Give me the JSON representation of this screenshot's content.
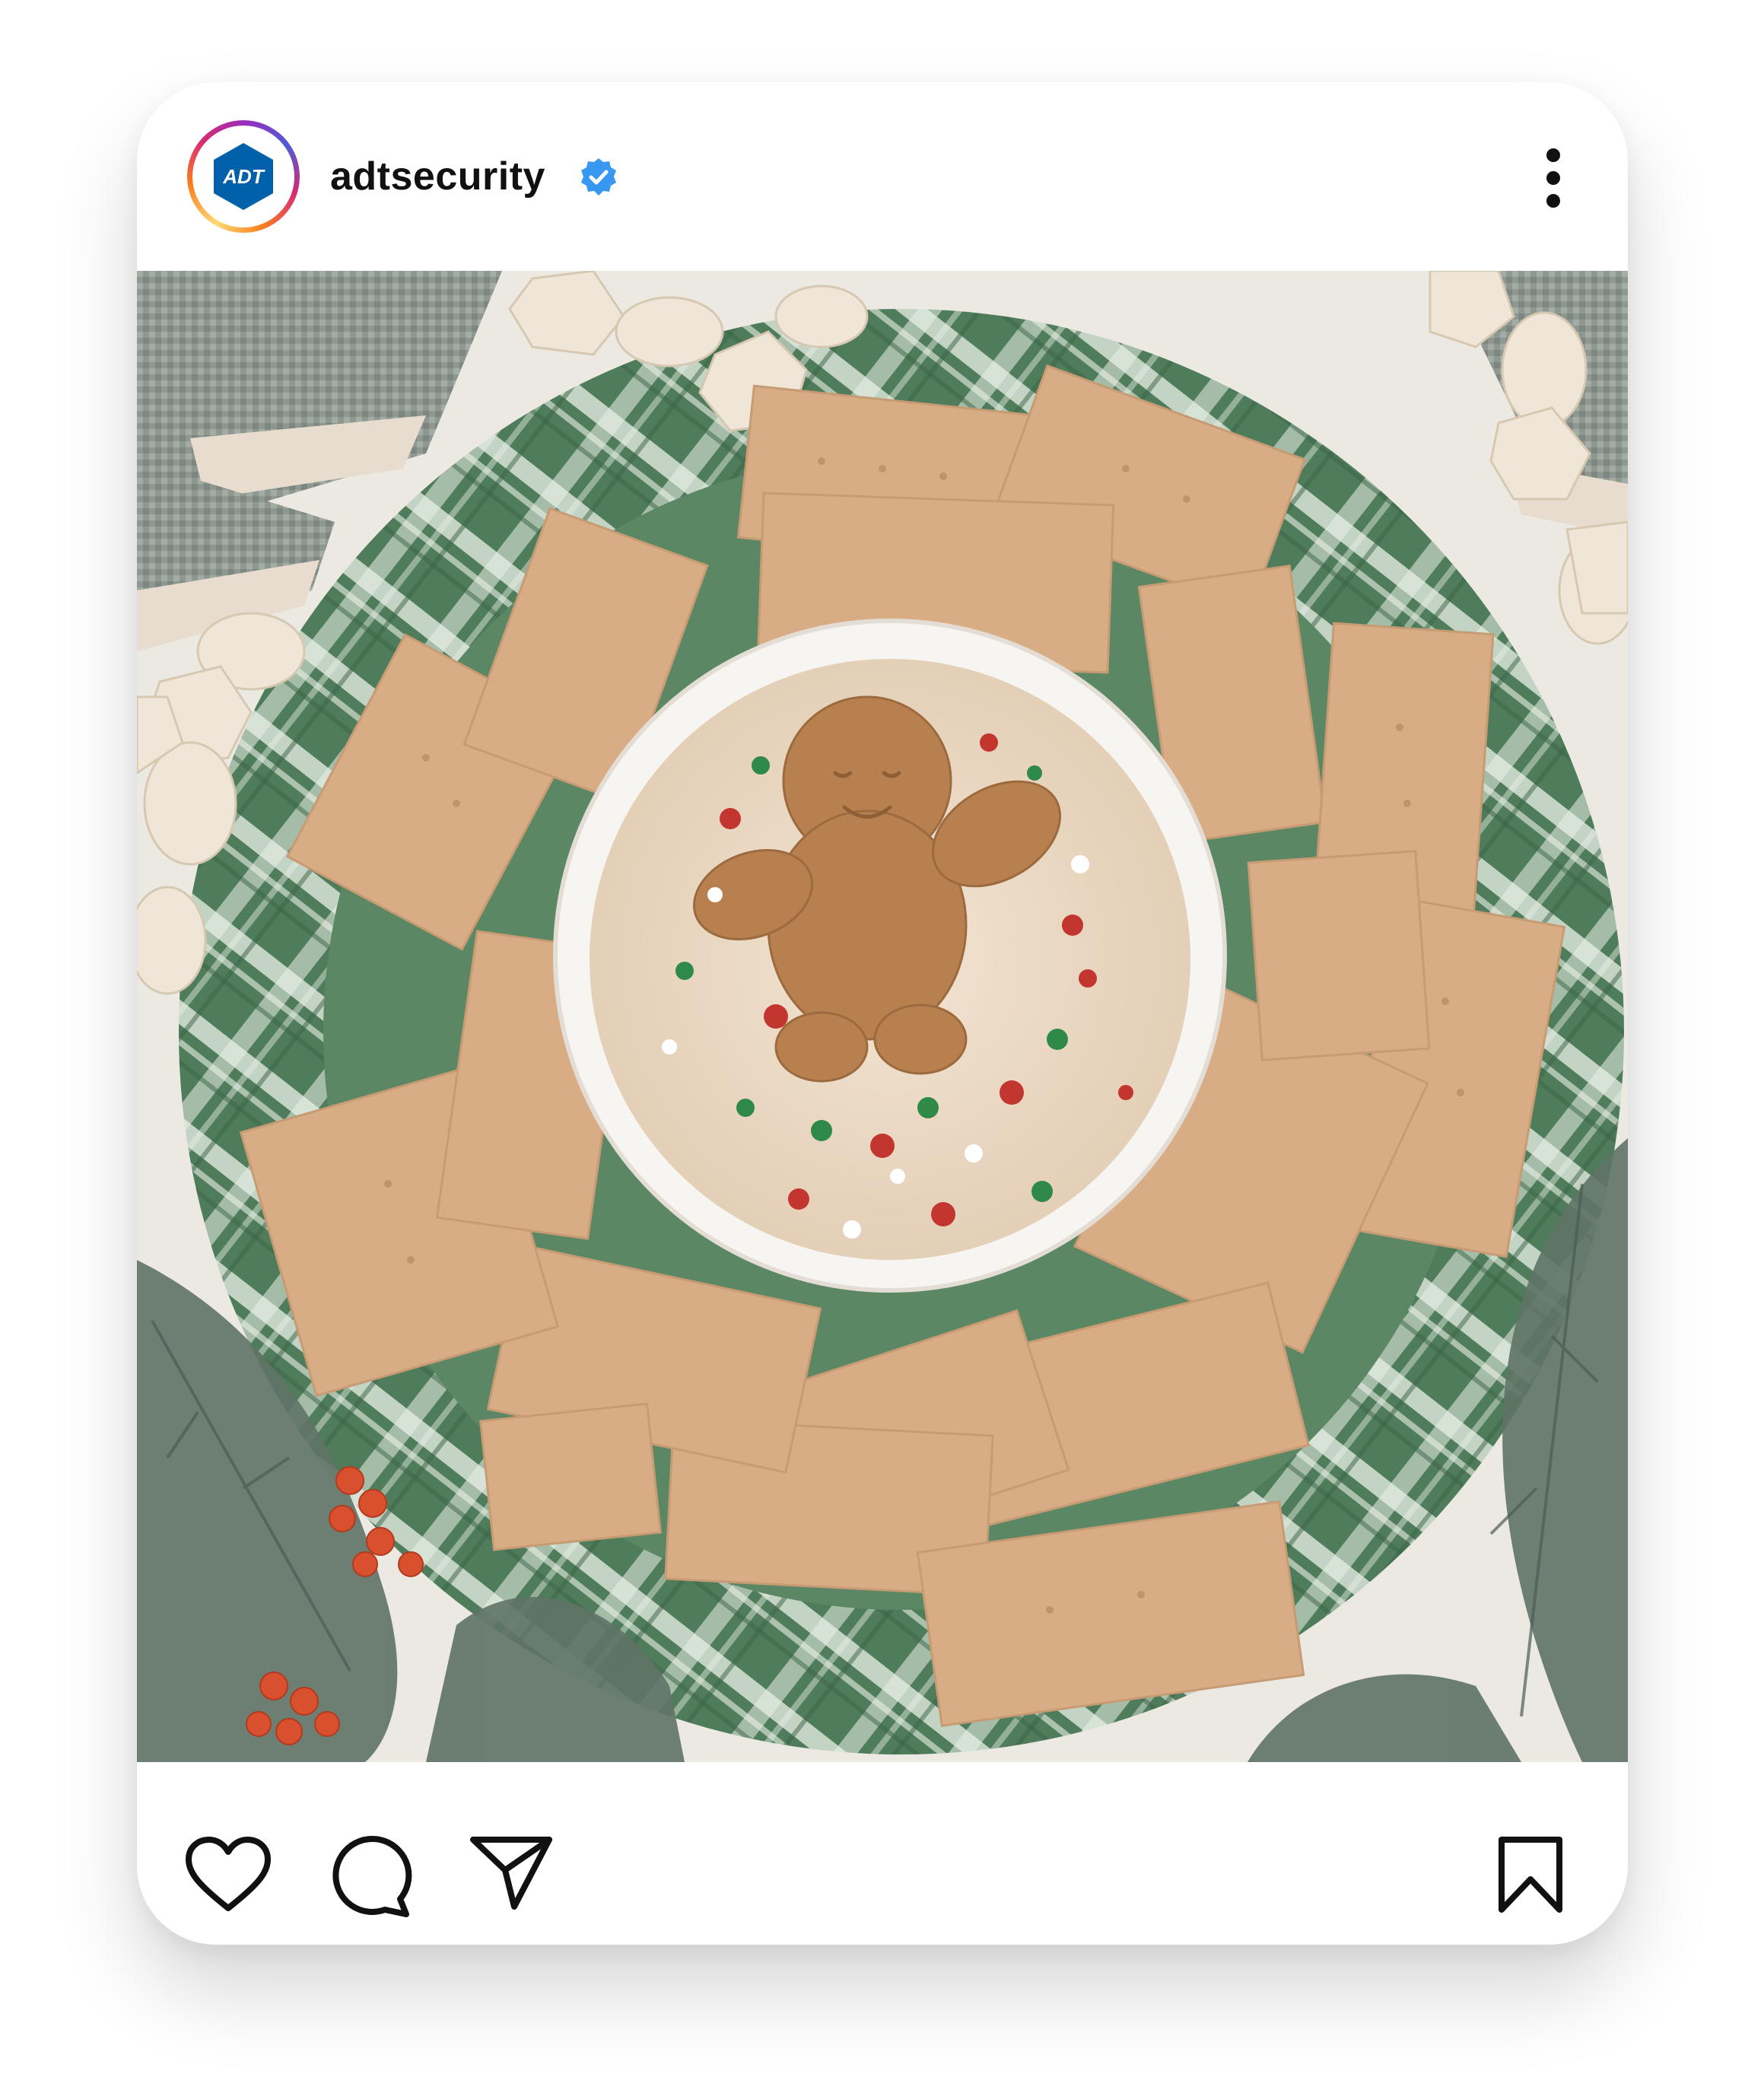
{
  "post": {
    "account": {
      "username": "adtsecurity",
      "avatar_label": "ADT",
      "verified": true
    },
    "icons": {
      "verified": "verified-badge-icon",
      "more": "more-options-icon",
      "like": "heart-icon",
      "comment": "comment-icon",
      "share": "send-icon",
      "save": "bookmark-icon"
    },
    "colors": {
      "brand_blue": "#0061aa",
      "verified_blue": "#3897f0",
      "plate_green": "#4d7a58",
      "cracker": "#d9b08a"
    }
  }
}
